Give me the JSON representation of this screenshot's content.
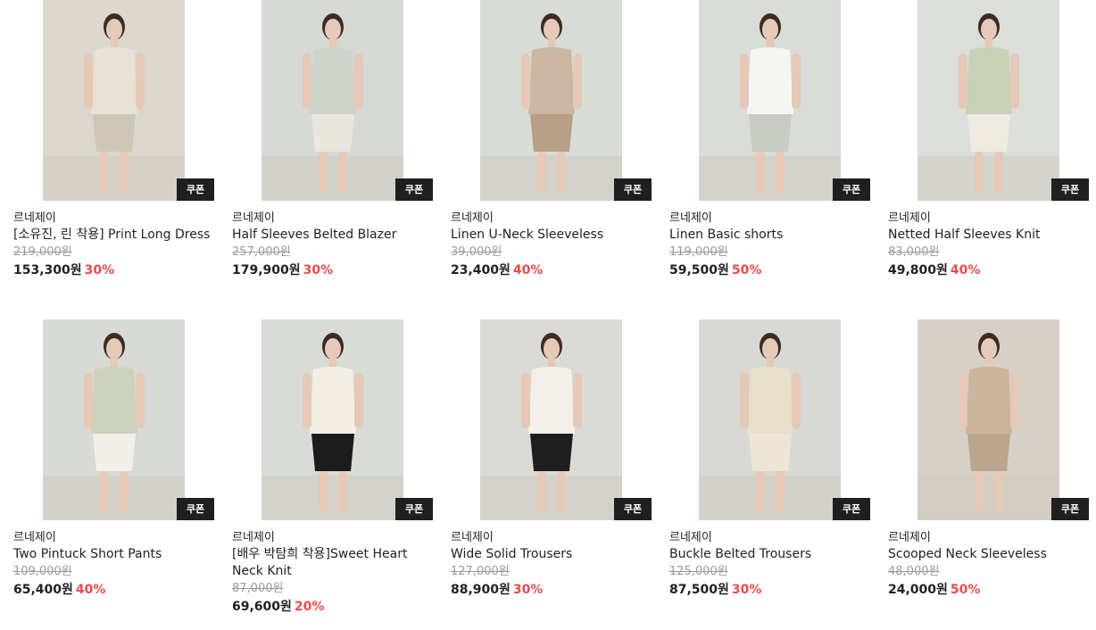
{
  "coupon_label": "쿠폰",
  "currency_suffix": "원",
  "products": [
    {
      "brand": "르네제이",
      "name": "[소유진, 린 착용] Print Long Dress",
      "original_price": "219,000원",
      "sale_price": "153,300원",
      "discount": "30%",
      "photo": {
        "bg": "#dcd8cf",
        "figure": "#e7e1d6",
        "accent": "#cfc7b6"
      }
    },
    {
      "brand": "르네제이",
      "name": "Half Sleeves Belted Blazer",
      "original_price": "257,000원",
      "sale_price": "179,900원",
      "discount": "30%",
      "photo": {
        "bg": "#d6d9d4",
        "figure": "#cfd3cb",
        "accent": "#e9e6de"
      }
    },
    {
      "brand": "르네제이",
      "name": "Linen U-Neck Sleeveless",
      "original_price": "39,000원",
      "sale_price": "23,400원",
      "discount": "40%",
      "photo": {
        "bg": "#d8dcd6",
        "figure": "#c9b7a3",
        "accent": "#b79f88"
      }
    },
    {
      "brand": "르네제이",
      "name": "Linen Basic shorts",
      "original_price": "119,000원",
      "sale_price": "59,500원",
      "discount": "50%",
      "photo": {
        "bg": "#d9dcd7",
        "figure": "#f5f5f3",
        "accent": "#c9ccc4"
      }
    },
    {
      "brand": "르네제이",
      "name": "Netted Half Sleeves Knit",
      "original_price": "83,000원",
      "sale_price": "49,800원",
      "discount": "40%",
      "photo": {
        "bg": "#dcded9",
        "figure": "#c9d1b8",
        "accent": "#eeeae1"
      }
    },
    {
      "brand": "르네제이",
      "name": "Two Pintuck Short Pants",
      "original_price": "109,000원",
      "sale_price": "65,400원",
      "discount": "40%",
      "photo": {
        "bg": "#d8dad6",
        "figure": "#cdd2bd",
        "accent": "#f2efe8"
      }
    },
    {
      "brand": "르네제이",
      "name": "[배우 박탐희 착용]Sweet Heart Neck Knit",
      "original_price": "87,000원",
      "sale_price": "69,600원",
      "discount": "20%",
      "photo": {
        "bg": "#d9dbd6",
        "figure": "#f3efe5",
        "accent": "#1c1c1c"
      }
    },
    {
      "brand": "르네제이",
      "name": "Wide Solid Trousers",
      "original_price": "127,000원",
      "sale_price": "88,900원",
      "discount": "30%",
      "photo": {
        "bg": "#dadbd6",
        "figure": "#f3f0e9",
        "accent": "#1e1e1e"
      }
    },
    {
      "brand": "르네제이",
      "name": "Buckle Belted Trousers",
      "original_price": "125,000원",
      "sale_price": "87,500원",
      "discount": "30%",
      "photo": {
        "bg": "#d8d9d4",
        "figure": "#e8dfcb",
        "accent": "#ede6d4"
      }
    },
    {
      "brand": "르네제이",
      "name": "Scooped Neck Sleeveless",
      "original_price": "48,000원",
      "sale_price": "24,000원",
      "discount": "50%",
      "photo": {
        "bg": "#d7d0c6",
        "figure": "#cbb59f",
        "accent": "#bca58e"
      }
    }
  ]
}
